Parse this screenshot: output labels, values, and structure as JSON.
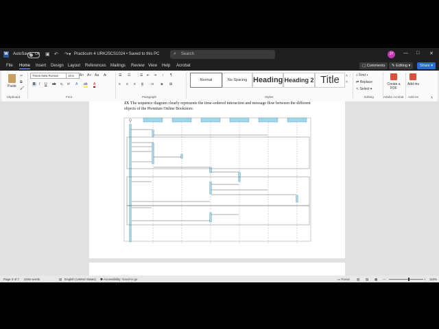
{
  "titlebar": {
    "autosave_label": "AutoSave",
    "autosave_state": "Off",
    "doc_title": "Practicum 4 URK25CS1024 • Saved to this PC",
    "search_placeholder": "Search",
    "avatar_initials": "JY",
    "icons": [
      "word-logo",
      "save-icon",
      "undo-icon",
      "redo-icon",
      "customize-icon",
      "minimize-icon",
      "maximize-icon",
      "close-icon"
    ]
  },
  "menu": {
    "tabs": [
      "File",
      "Home",
      "Insert",
      "Design",
      "Layout",
      "References",
      "Mailings",
      "Review",
      "View",
      "Help",
      "Acrobat"
    ],
    "active_tab": "Home",
    "comments": "Comments",
    "editing": "Editing",
    "share": "Share"
  },
  "ribbon": {
    "clipboard": {
      "paste": "Paste",
      "label": "Clipboard"
    },
    "font": {
      "name": "Times New Roman",
      "size": "10.5",
      "label": "Font"
    },
    "paragraph": {
      "label": "Paragraph"
    },
    "styles": {
      "items": [
        "Normal",
        "No Spacing",
        "Heading 1",
        "Heading 2",
        "Title"
      ],
      "label": "Styles"
    },
    "editing": {
      "find": "Find",
      "replace": "Replace",
      "select": "Select",
      "label": "Editing"
    },
    "acrobat": {
      "create_pdf": "Create a PDF",
      "label": "Adobe Acrobat"
    },
    "addins": {
      "addins": "Add-ins",
      "label": "Add-ins"
    }
  },
  "document": {
    "caption_number": "13.",
    "caption_text": "The sequence diagram clearly represents the time-ordered interaction and message flow between the different objects of the Premium Online Bookstore."
  },
  "statusbar": {
    "page": "Page 3 of 7",
    "words": "2246 words",
    "language": "English (United States)",
    "accessibility": "Accessibility: Good to go",
    "focus": "Focus",
    "zoom": "110%"
  }
}
